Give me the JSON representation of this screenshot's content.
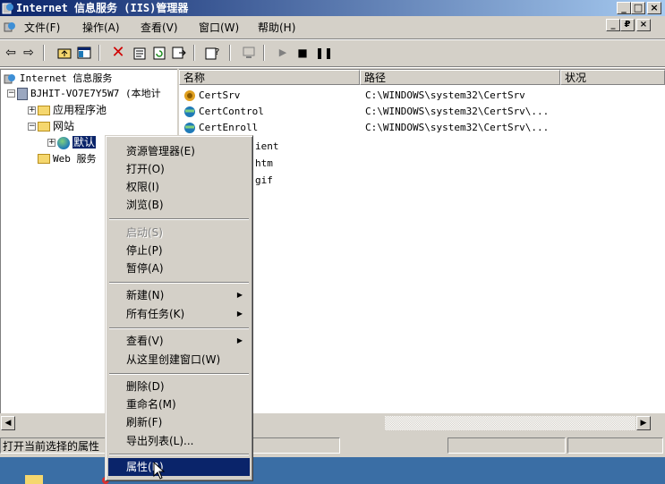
{
  "window": {
    "title": "Internet 信息服务 (IIS)管理器",
    "caption_buttons": [
      "_",
      "□",
      "×"
    ],
    "mdi_buttons": [
      "_",
      "₽",
      "×"
    ]
  },
  "menu": [
    "文件(F)",
    "操作(A)",
    "查看(V)",
    "窗口(W)",
    "帮助(H)"
  ],
  "toolbar": {
    "icons": [
      "back-arrow-icon",
      "forward-arrow-icon",
      "up-folder-icon",
      "show-tree-icon",
      "delete-x-icon",
      "properties-icon",
      "refresh-icon",
      "export-icon",
      "help-icon",
      "computer-icon",
      "play-icon",
      "stop-icon",
      "pause-icon"
    ]
  },
  "tree": {
    "root": "Internet 信息服务",
    "server": "BJHIT-VO7E7Y5W7 (本地计",
    "app_pools": "应用程序池",
    "websites": "网站",
    "default_site": "默认",
    "web_service": "Web 服务"
  },
  "list": {
    "columns": [
      "名称",
      "路径",
      "状况"
    ],
    "rows": [
      {
        "name": "CertSrv",
        "path": "C:\\WINDOWS\\system32\\CertSrv",
        "icon": "app-icon"
      },
      {
        "name": "CertControl",
        "path": "C:\\WINDOWS\\system32\\CertSrv\\...",
        "icon": "globe-folder-icon"
      },
      {
        "name": "CertEnroll",
        "path": "C:\\WINDOWS\\system32\\CertSrv\\...",
        "icon": "globe-folder-icon"
      },
      {
        "name": "ient",
        "path": "",
        "icon": ""
      },
      {
        "name": "htm",
        "path": "",
        "icon": ""
      },
      {
        "name": "gif",
        "path": "",
        "icon": ""
      }
    ]
  },
  "context_menu": {
    "items": [
      {
        "label": "资源管理器(E)",
        "disabled": false
      },
      {
        "label": "打开(O)",
        "disabled": false
      },
      {
        "label": "权限(I)",
        "disabled": false
      },
      {
        "label": "浏览(B)",
        "disabled": false
      },
      {
        "label": "启动(S)",
        "disabled": true
      },
      {
        "label": "停止(P)",
        "disabled": false
      },
      {
        "label": "暂停(A)",
        "disabled": false
      },
      {
        "label": "新建(N)",
        "disabled": false,
        "submenu": true
      },
      {
        "label": "所有任务(K)",
        "disabled": false,
        "submenu": true
      },
      {
        "label": "查看(V)",
        "disabled": false,
        "submenu": true
      },
      {
        "label": "从这里创建窗口(W)",
        "disabled": false
      },
      {
        "label": "删除(D)",
        "disabled": false
      },
      {
        "label": "重命名(M)",
        "disabled": false
      },
      {
        "label": "刷新(F)",
        "disabled": false
      },
      {
        "label": "导出列表(L)...",
        "disabled": false
      },
      {
        "label": "属性(R)",
        "disabled": false,
        "highlighted": true
      }
    ]
  },
  "status": {
    "text": "打开当前选择的属性"
  },
  "colors": {
    "title_start": "#0a246a",
    "title_end": "#a6caf0",
    "face": "#d4d0c8",
    "highlight": "#0a246a",
    "desktop": "#3a6ea5"
  }
}
